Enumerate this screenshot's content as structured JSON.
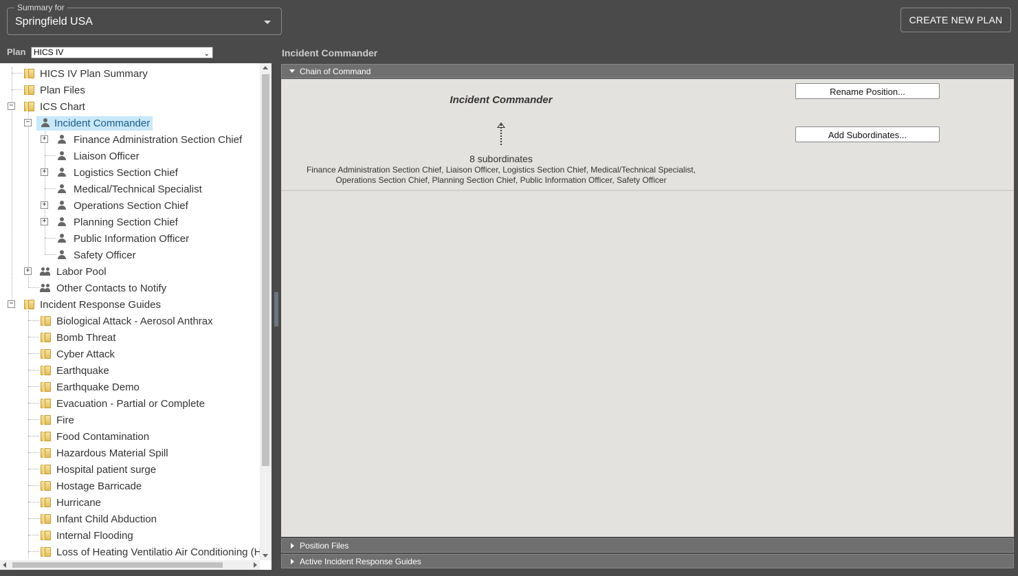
{
  "header": {
    "summary_legend": "Summary for",
    "summary_value": "Springfield USA",
    "create_button": "CREATE NEW PLAN"
  },
  "plan": {
    "label": "Plan",
    "selected": "HICS IV"
  },
  "tree": {
    "items": [
      {
        "label": "HICS IV Plan Summary",
        "icon": "folder-icon"
      },
      {
        "label": "Plan Files",
        "icon": "folder-icon"
      },
      {
        "label": "ICS Chart",
        "icon": "folder-icon"
      },
      {
        "label": "Incident Commander",
        "icon": "person-icon"
      },
      {
        "label": "Finance Administration Section Chief",
        "icon": "person-icon"
      },
      {
        "label": "Liaison Officer",
        "icon": "person-icon"
      },
      {
        "label": "Logistics Section Chief",
        "icon": "person-icon"
      },
      {
        "label": "Medical/Technical Specialist",
        "icon": "person-icon"
      },
      {
        "label": "Operations Section Chief",
        "icon": "person-icon"
      },
      {
        "label": "Planning Section Chief",
        "icon": "person-icon"
      },
      {
        "label": "Public Information Officer",
        "icon": "person-icon"
      },
      {
        "label": "Safety Officer",
        "icon": "person-icon"
      },
      {
        "label": "Labor Pool",
        "icon": "people-icon"
      },
      {
        "label": "Other Contacts to Notify",
        "icon": "people-icon"
      },
      {
        "label": "Incident Response Guides",
        "icon": "folder-icon"
      },
      {
        "label": "Biological Attack - Aerosol Anthrax",
        "icon": "folder-icon"
      },
      {
        "label": "Bomb Threat",
        "icon": "folder-icon"
      },
      {
        "label": "Cyber Attack",
        "icon": "folder-icon"
      },
      {
        "label": "Earthquake",
        "icon": "folder-icon"
      },
      {
        "label": "Earthquake Demo",
        "icon": "folder-icon"
      },
      {
        "label": "Evacuation - Partial or Complete",
        "icon": "folder-icon"
      },
      {
        "label": "Fire",
        "icon": "folder-icon"
      },
      {
        "label": "Food Contamination",
        "icon": "folder-icon"
      },
      {
        "label": "Hazardous Material Spill",
        "icon": "folder-icon"
      },
      {
        "label": "Hospital patient surge",
        "icon": "folder-icon"
      },
      {
        "label": "Hostage Barricade",
        "icon": "folder-icon"
      },
      {
        "label": "Hurricane",
        "icon": "folder-icon"
      },
      {
        "label": "Infant Child Abduction",
        "icon": "folder-icon"
      },
      {
        "label": "Internal Flooding",
        "icon": "folder-icon"
      },
      {
        "label": "Loss of Heating Ventilatio Air Conditioning (H",
        "icon": "folder-icon"
      }
    ]
  },
  "main": {
    "title": "Incident Commander",
    "chain_header": "Chain of Command",
    "position_name": "Incident Commander",
    "subordinate_count": "8 subordinates",
    "subordinate_list": "Finance Administration Section Chief, Liaison Officer, Logistics Section Chief, Medical/Technical Specialist, Operations Section Chief, Planning Section Chief, Public Information Officer, Safety Officer",
    "rename_button": "Rename Position...",
    "add_button": "Add Subordinates...",
    "position_files_header": "Position Files",
    "active_guides_header": "Active Incident Response Guides"
  },
  "colors": {
    "background": "#4a4a4a",
    "selection": "#c9e8f8",
    "panel": "#e3e2df",
    "accordion_header": "#6f6f6f"
  }
}
